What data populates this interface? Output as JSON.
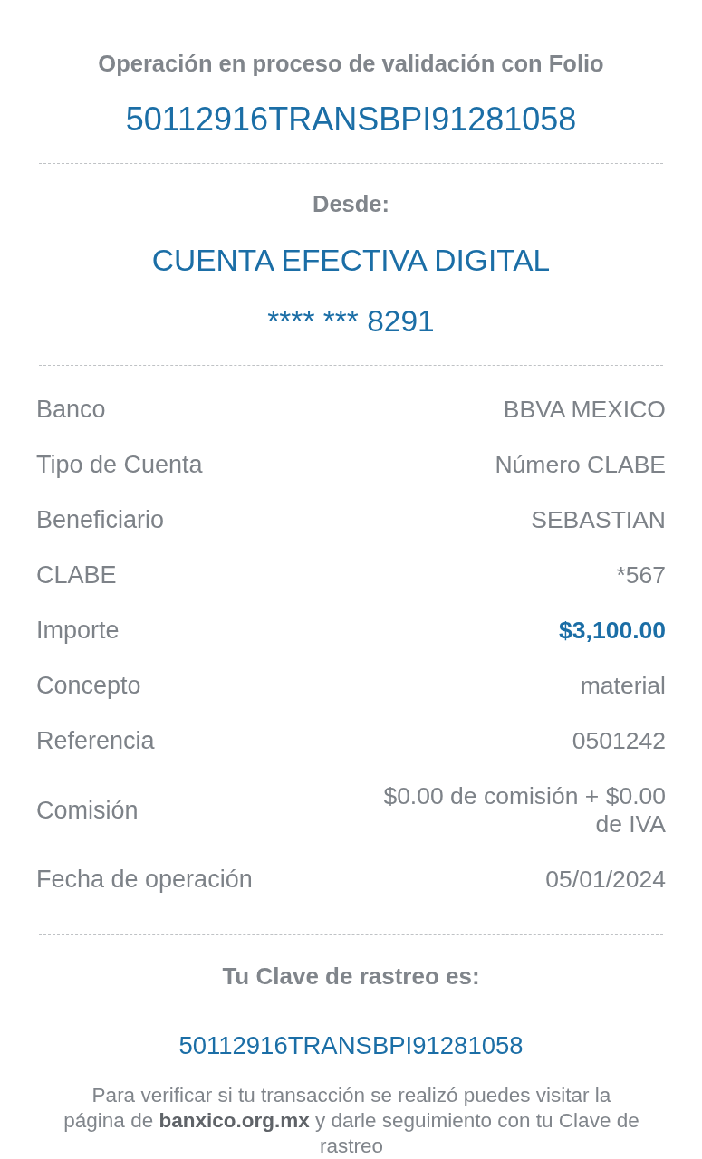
{
  "header": {
    "caption": "Operación en proceso de validación con Folio",
    "folio": "50112916TRANSBPI91281058"
  },
  "origin": {
    "label": "Desde:",
    "account_name": "CUENTA EFECTIVA DIGITAL",
    "account_number": "**** *** 8291"
  },
  "details": [
    {
      "label": "Banco",
      "value": "BBVA MEXICO",
      "highlighted": false
    },
    {
      "label": "Tipo de Cuenta",
      "value": "Número CLABE",
      "highlighted": false
    },
    {
      "label": "Beneficiario",
      "value": "SEBASTIAN",
      "highlighted": false
    },
    {
      "label": "CLABE",
      "value": "*567",
      "highlighted": false
    },
    {
      "label": "Importe",
      "value": "$3,100.00",
      "highlighted": true
    },
    {
      "label": "Concepto",
      "value": "material",
      "highlighted": false
    },
    {
      "label": "Referencia",
      "value": "0501242",
      "highlighted": false
    },
    {
      "label": "Comisión",
      "value": "$0.00 de comisión + $0.00 de IVA",
      "highlighted": false
    },
    {
      "label": "Fecha de operación",
      "value": "05/01/2024",
      "highlighted": false
    }
  ],
  "tracking": {
    "label": "Tu Clave de rastreo es:",
    "code": "50112916TRANSBPI91281058",
    "note": "Para verificar si tu transacción se realizó puedes visitar la página de **banxico.org.mx** y darle seguimiento con tu Clave de rastreo"
  }
}
